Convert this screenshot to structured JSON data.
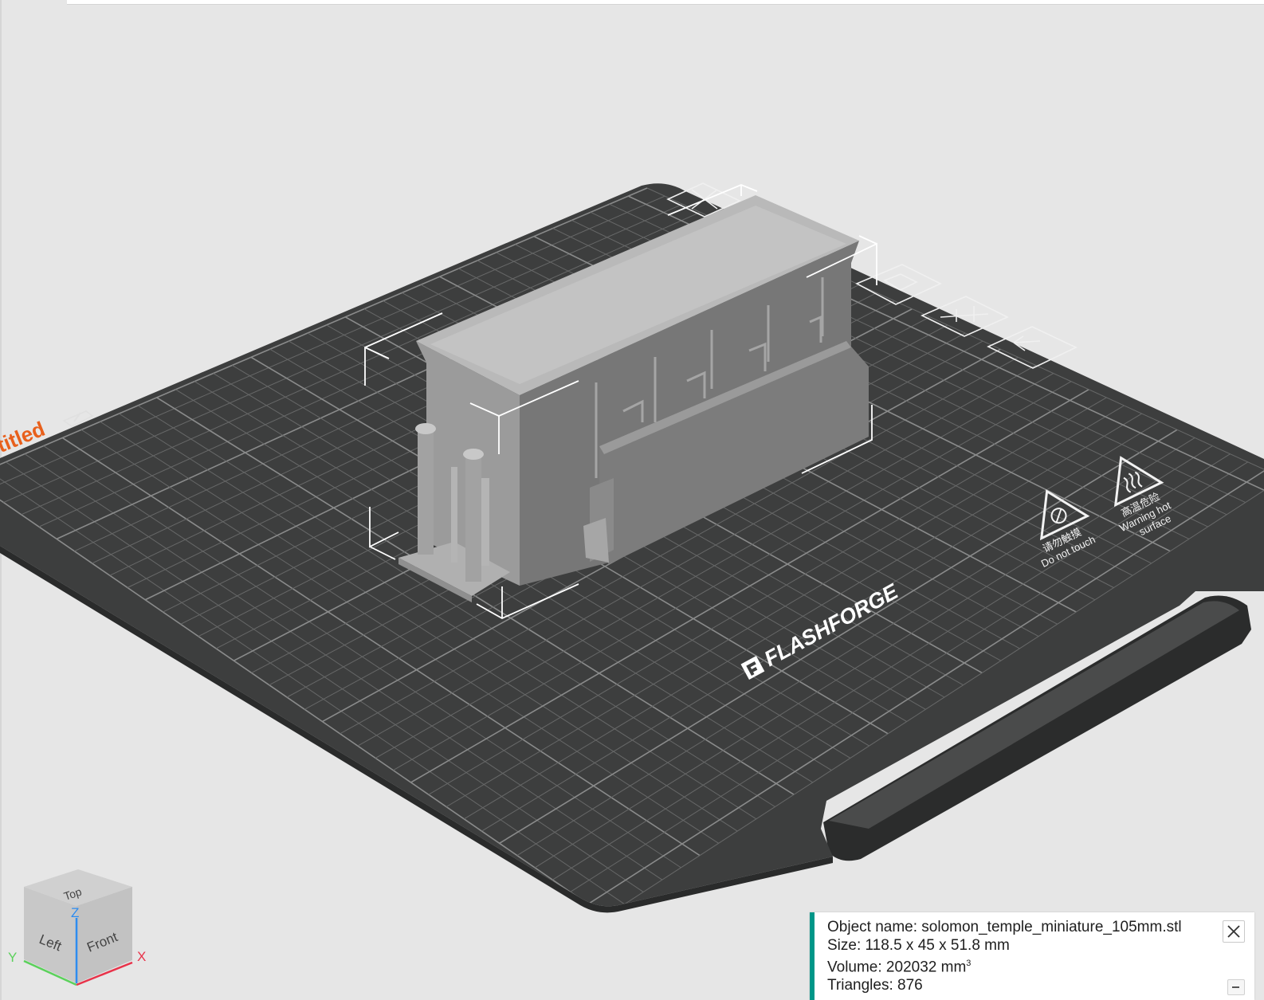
{
  "viewport": {
    "plate_name": "ıtitled",
    "plate_name_color": "#e8601c",
    "bed_color": "#3d3e3e",
    "brand": "FLASHFORGE",
    "warning_touch": {
      "cn": "请勿触摸",
      "en": "Do not touch"
    },
    "warning_hot": {
      "cn": "高温危险",
      "en1": "Warning hot",
      "en2": "surface"
    }
  },
  "view_cube": {
    "top": "Top",
    "left": "Left",
    "front": "Front",
    "axis_x": "X",
    "axis_y": "Y",
    "axis_z": "Z",
    "axis_x_color": "#e8334a",
    "axis_y_color": "#5bd15b",
    "axis_z_color": "#2d8cf0"
  },
  "object_info": {
    "name": "Object name: solomon_temple_miniature_105mm.stl",
    "size": "Size: 118.5 x 45 x 51.8 mm",
    "volume": "Volume: 202032 mm",
    "volume_unit_sup": "3",
    "triangles": "Triangles: 876",
    "accent_color": "#009688"
  }
}
